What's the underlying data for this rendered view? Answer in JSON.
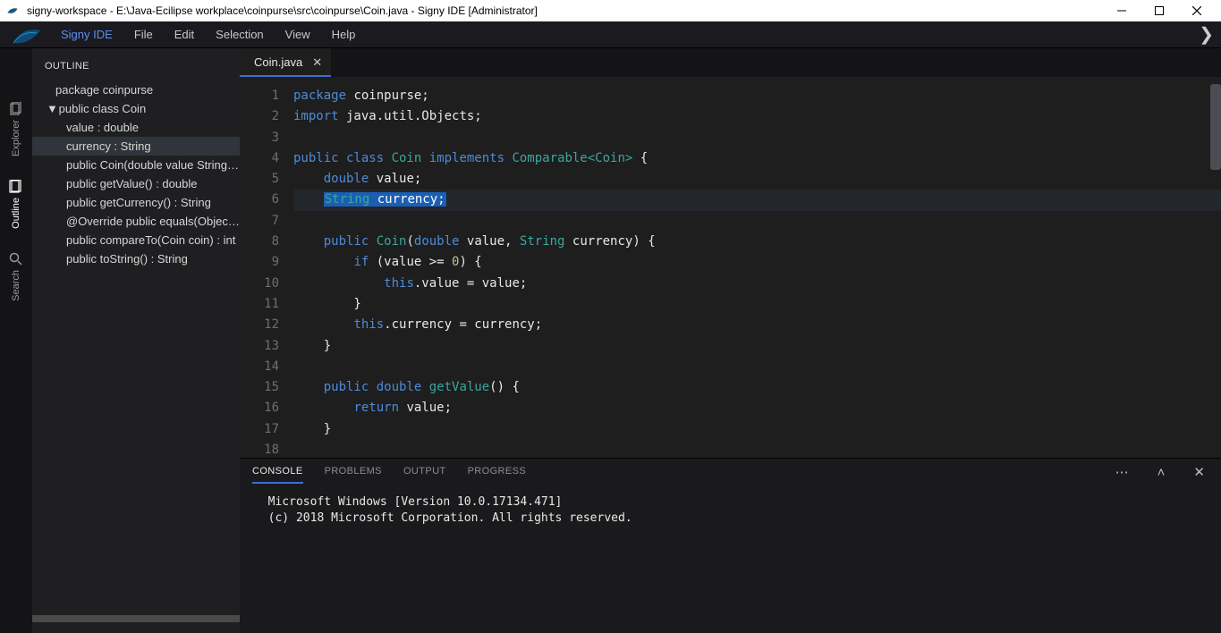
{
  "window": {
    "title": "signy-workspace - E:\\Java-Ecilipse workplace\\coinpurse\\src\\coinpurse\\Coin.java - Signy IDE [Administrator]"
  },
  "menu": {
    "app": "Signy IDE",
    "items": [
      "File",
      "Edit",
      "Selection",
      "View",
      "Help"
    ]
  },
  "activity": {
    "tabs": [
      "Explorer",
      "Outline",
      "Search"
    ],
    "active_index": 1
  },
  "sidebar": {
    "title": "OUTLINE",
    "items": [
      {
        "label": "package coinpurse",
        "level": 0,
        "selected": false
      },
      {
        "label": "public class Coin",
        "level": 0,
        "selected": false,
        "caret": "▼"
      },
      {
        "label": "value : double",
        "level": 2,
        "selected": false
      },
      {
        "label": "currency : String",
        "level": 2,
        "selected": true
      },
      {
        "label": "public Coin(double value String currency)",
        "level": 2,
        "selected": false
      },
      {
        "label": "public getValue() : double",
        "level": 2,
        "selected": false
      },
      {
        "label": "public getCurrency() : String",
        "level": 2,
        "selected": false
      },
      {
        "label": "@Override public equals(Object obj) : boolean",
        "level": 2,
        "selected": false
      },
      {
        "label": "public compareTo(Coin coin) : int",
        "level": 2,
        "selected": false
      },
      {
        "label": "public toString() : String",
        "level": 2,
        "selected": false
      }
    ]
  },
  "tabs": {
    "open": [
      {
        "name": "Coin.java",
        "active": true
      }
    ]
  },
  "editor": {
    "lines": [
      1,
      2,
      3,
      4,
      5,
      6,
      7,
      8,
      9,
      10,
      11,
      12,
      13,
      14,
      15,
      16,
      17,
      18
    ],
    "highlighted_line": 6,
    "selection": "String currency;",
    "code_tokens": {
      "l1": [
        "package",
        " coinpurse;"
      ],
      "l2": [
        "import",
        " java.util.Objects;"
      ],
      "l4": [
        "public class ",
        "Coin",
        " implements ",
        "Comparable<Coin>",
        " {"
      ],
      "l5": [
        "    ",
        "double",
        " value;"
      ],
      "l6": [
        "    ",
        "String",
        " currency;"
      ],
      "l8": [
        "    ",
        "public ",
        "Coin",
        "(",
        "double",
        " value, ",
        "String",
        " currency) {"
      ],
      "l9": [
        "        ",
        "if",
        " (value >= ",
        "0",
        ") {"
      ],
      "l10": [
        "            ",
        "this",
        ".value = value;"
      ],
      "l11": [
        "        }"
      ],
      "l12": [
        "        ",
        "this",
        ".currency = currency;"
      ],
      "l13": [
        "    }"
      ],
      "l15": [
        "    ",
        "public double ",
        "getValue",
        "() {"
      ],
      "l16": [
        "        ",
        "return",
        " value;"
      ],
      "l17": [
        "    }"
      ]
    }
  },
  "panel": {
    "tabs": [
      "CONSOLE",
      "PROBLEMS",
      "OUTPUT",
      "PROGRESS"
    ],
    "active_index": 0,
    "console_text": "  Microsoft Windows [Version 10.0.17134.471]\n  (c) 2018 Microsoft Corporation. All rights reserved."
  }
}
